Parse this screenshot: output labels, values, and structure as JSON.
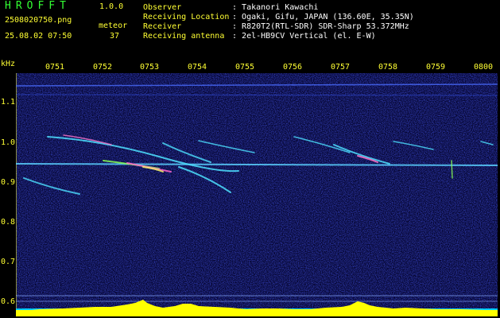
{
  "header": {
    "title": "HROFFT",
    "version": "1.0.0",
    "filename": "2508020750.png",
    "datetime": "25.08.02 07:50",
    "meteor_label": "meteor",
    "meteor_count": "37"
  },
  "info": [
    {
      "key": "Observer",
      "value": "Takanori Kawachi"
    },
    {
      "key": "Receiving Location",
      "value": "Ogaki, Gifu, JAPAN (136.60E, 35.35N)"
    },
    {
      "key": "Receiver",
      "value": "R820T2(RTL-SDR) SDR-Sharp 53.372MHz"
    },
    {
      "key": "Receiving antenna",
      "value": "2el-HB9CV Vertical (el. E-W)"
    }
  ],
  "axis": {
    "y_unit": "kHz",
    "y_ticks": [
      "1.1",
      "1.0",
      "0.9",
      "0.8",
      "0.7",
      "0.6"
    ],
    "x_ticks": [
      "0751",
      "0752",
      "0753",
      "0754",
      "0755",
      "0756",
      "0757",
      "0758",
      "0759",
      "0800"
    ]
  },
  "colors": {
    "label": "#ffff33",
    "title": "#33ff33",
    "text": "#ffffff",
    "background_noise": "#0a0a66",
    "baseline": "#00ccff",
    "activity": "#ffff00"
  }
}
